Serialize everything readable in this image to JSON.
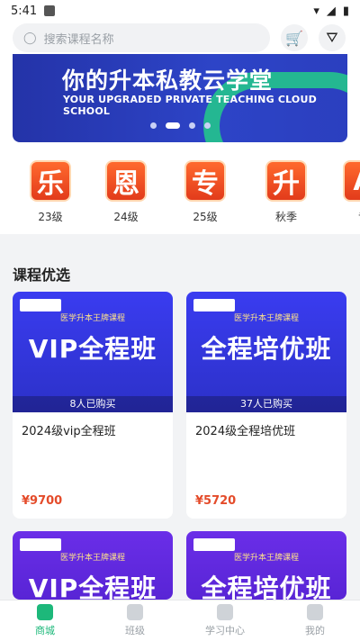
{
  "status": {
    "time": "5:41"
  },
  "search": {
    "placeholder": "搜索课程名称"
  },
  "banner": {
    "title": "你的升本私教云学堂",
    "subtitle": "YOUR UPGRADED PRIVATE TEACHING CLOUD SCHOOL"
  },
  "categories": [
    {
      "char": "乐",
      "label": "23级"
    },
    {
      "char": "恩",
      "label": "24级"
    },
    {
      "char": "专",
      "label": "25级"
    },
    {
      "char": "升",
      "label": "秋季"
    },
    {
      "char": "A",
      "label": "专"
    }
  ],
  "section": {
    "title": "课程优选"
  },
  "cards": [
    {
      "top_text": "医学升本王牌课程",
      "big": "VIP全程班",
      "bought": "8人已购买",
      "name": "2024级vip全程班",
      "price": "¥9700"
    },
    {
      "top_text": "医学升本王牌课程",
      "big": "全程培优班",
      "bought": "37人已购买",
      "name": "2024级全程培优班",
      "price": "¥5720"
    },
    {
      "top_text": "医学升本王牌课程",
      "big": "VIP全程班"
    },
    {
      "top_text": "医学升本王牌课程",
      "big": "全程培优班"
    }
  ],
  "tabs": [
    {
      "label": "商城"
    },
    {
      "label": "班级"
    },
    {
      "label": "学习中心"
    },
    {
      "label": "我的"
    }
  ]
}
